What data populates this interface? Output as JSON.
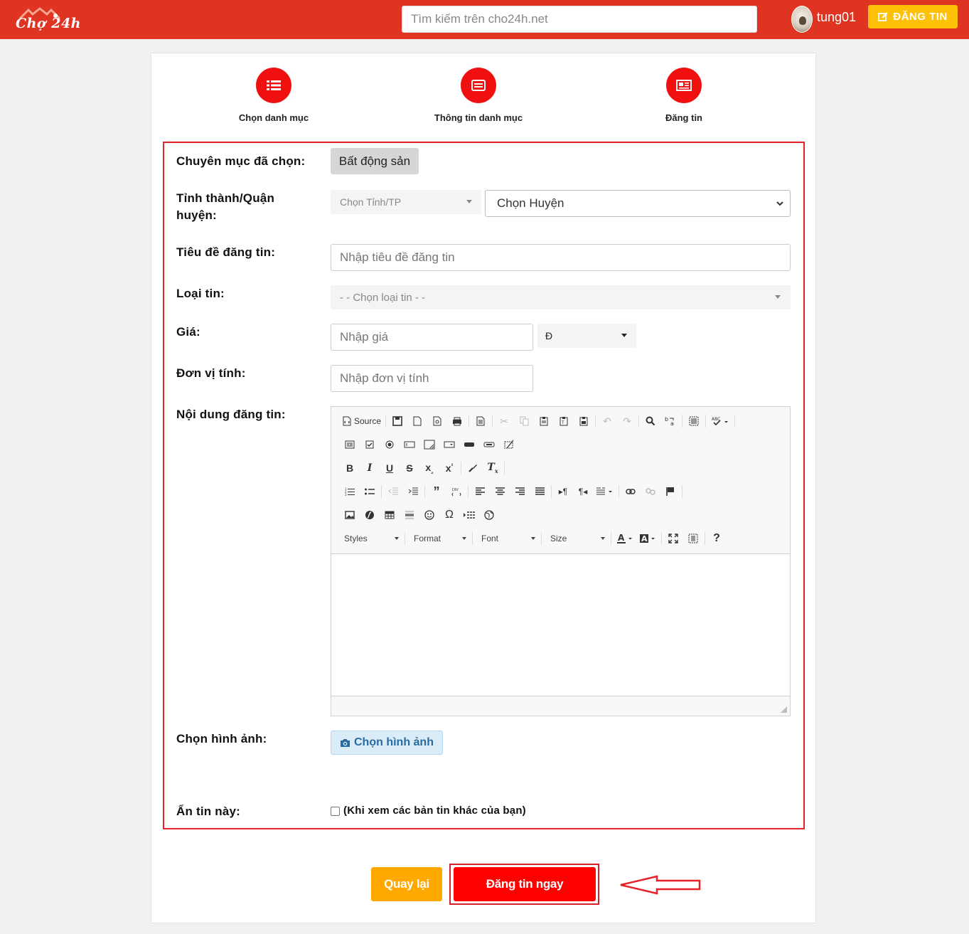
{
  "header": {
    "logo_text": "Chợ 24h",
    "search_placeholder": "Tìm kiếm trên cho24h.net",
    "username": "tung01",
    "post_button": "ĐĂNG TIN"
  },
  "steps": [
    {
      "label": "Chọn danh mục",
      "icon": "list-icon"
    },
    {
      "label": "Thông tin danh mục",
      "icon": "card-icon"
    },
    {
      "label": "Đăng tin",
      "icon": "newspaper-icon"
    }
  ],
  "form": {
    "category_label": "Chuyên mục đã chọn:",
    "category_value": "Bất động sản",
    "location_label_line1": "Tỉnh thành/Quận",
    "location_label_line2": "huyện:",
    "province_placeholder": "Chọn Tỉnh/TP",
    "district_value": "Chọn Huyện",
    "title_label": "Tiêu đề đăng tin:",
    "title_placeholder": "Nhập tiêu đề đăng tin",
    "type_label": "Loại tin:",
    "type_placeholder": "- - Chọn loại tin - -",
    "price_label": "Giá:",
    "price_placeholder": "Nhập giá",
    "currency_value": "Đ",
    "unit_label": "Đơn vị tính:",
    "unit_placeholder": "Nhập đơn vị tính",
    "content_label": "Nội dung đăng tin:",
    "image_label": "Chọn hình ảnh:",
    "image_button": "Chọn hình ảnh",
    "hide_label": "Ẩn tin này:",
    "hide_checkbox_label": "(Khi xem các bản tin khác của bạn)"
  },
  "editor": {
    "source_label": "Source",
    "styles_label": "Styles",
    "format_label": "Format",
    "font_label": "Font",
    "size_label": "Size"
  },
  "actions": {
    "back_button": "Quay lại",
    "submit_button": "Đăng tin ngay"
  },
  "colors": {
    "header_bg": "#df3422",
    "accent_red": "#f01010",
    "yellow": "#ffc107",
    "orange": "#ffa800"
  }
}
